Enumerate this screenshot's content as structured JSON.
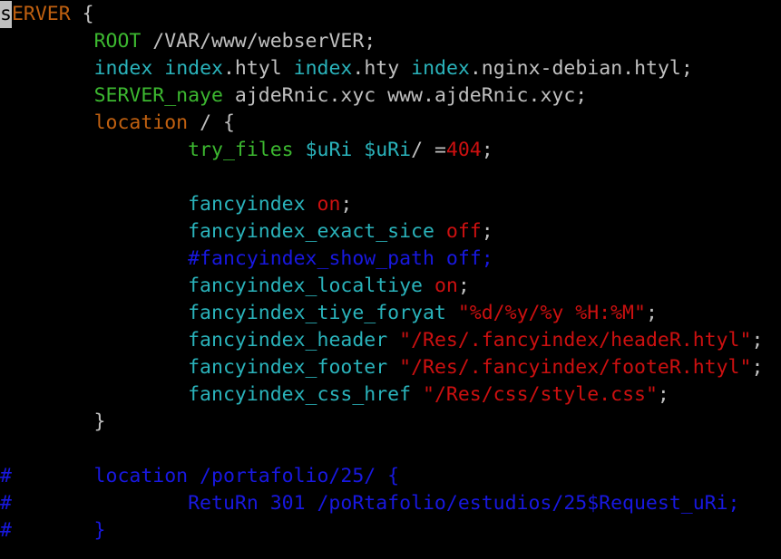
{
  "editor": {
    "cursor_char": "s",
    "lines": [
      [
        {
          "t": "ERVER",
          "c": "keyword"
        },
        {
          "t": " {",
          "c": "plain"
        }
      ],
      [
        {
          "t": "        ",
          "c": "plain"
        },
        {
          "t": "ROOT",
          "c": "directive"
        },
        {
          "t": " /VAR/www/webserVER;",
          "c": "plain"
        }
      ],
      [
        {
          "t": "        ",
          "c": "plain"
        },
        {
          "t": "index",
          "c": "module"
        },
        {
          "t": " ",
          "c": "plain"
        },
        {
          "t": "index",
          "c": "module"
        },
        {
          "t": ".htyl ",
          "c": "plain"
        },
        {
          "t": "index",
          "c": "module"
        },
        {
          "t": ".hty ",
          "c": "plain"
        },
        {
          "t": "index",
          "c": "module"
        },
        {
          "t": ".nginx-debian.htyl;",
          "c": "plain"
        }
      ],
      [
        {
          "t": "        ",
          "c": "plain"
        },
        {
          "t": "SERVER_naye",
          "c": "directive"
        },
        {
          "t": " ajdeRnic.xyc www.ajdeRnic.xyc;",
          "c": "plain"
        }
      ],
      [
        {
          "t": "        ",
          "c": "plain"
        },
        {
          "t": "location",
          "c": "keyword"
        },
        {
          "t": " / {",
          "c": "plain"
        }
      ],
      [
        {
          "t": "                ",
          "c": "plain"
        },
        {
          "t": "try_files",
          "c": "directive"
        },
        {
          "t": " ",
          "c": "plain"
        },
        {
          "t": "$uRi",
          "c": "module"
        },
        {
          "t": " ",
          "c": "plain"
        },
        {
          "t": "$uRi",
          "c": "module"
        },
        {
          "t": "/ =",
          "c": "plain"
        },
        {
          "t": "404",
          "c": "value"
        },
        {
          "t": ";",
          "c": "plain"
        }
      ],
      [],
      [
        {
          "t": "                ",
          "c": "plain"
        },
        {
          "t": "fancyindex",
          "c": "module"
        },
        {
          "t": " ",
          "c": "plain"
        },
        {
          "t": "on",
          "c": "value"
        },
        {
          "t": ";",
          "c": "plain"
        }
      ],
      [
        {
          "t": "                ",
          "c": "plain"
        },
        {
          "t": "fancyindex_exact_sice",
          "c": "module"
        },
        {
          "t": " ",
          "c": "plain"
        },
        {
          "t": "off",
          "c": "value"
        },
        {
          "t": ";",
          "c": "plain"
        }
      ],
      [
        {
          "t": "                ",
          "c": "plain"
        },
        {
          "t": "#fancyindex_show_path off;",
          "c": "comment"
        }
      ],
      [
        {
          "t": "                ",
          "c": "plain"
        },
        {
          "t": "fancyindex_localtiye",
          "c": "module"
        },
        {
          "t": " ",
          "c": "plain"
        },
        {
          "t": "on",
          "c": "value"
        },
        {
          "t": ";",
          "c": "plain"
        }
      ],
      [
        {
          "t": "                ",
          "c": "plain"
        },
        {
          "t": "fancyindex_tiye_foryat",
          "c": "module"
        },
        {
          "t": " ",
          "c": "plain"
        },
        {
          "t": "\"%d/%y/%y %H:%M\"",
          "c": "string"
        },
        {
          "t": ";",
          "c": "plain"
        }
      ],
      [
        {
          "t": "                ",
          "c": "plain"
        },
        {
          "t": "fancyindex_header",
          "c": "module"
        },
        {
          "t": " ",
          "c": "plain"
        },
        {
          "t": "\"/Res/.fancyindex/headeR.htyl\"",
          "c": "string"
        },
        {
          "t": ";",
          "c": "plain"
        }
      ],
      [
        {
          "t": "                ",
          "c": "plain"
        },
        {
          "t": "fancyindex_footer",
          "c": "module"
        },
        {
          "t": " ",
          "c": "plain"
        },
        {
          "t": "\"/Res/.fancyindex/footeR.htyl\"",
          "c": "string"
        },
        {
          "t": ";",
          "c": "plain"
        }
      ],
      [
        {
          "t": "                ",
          "c": "plain"
        },
        {
          "t": "fancyindex_css_href",
          "c": "module"
        },
        {
          "t": " ",
          "c": "plain"
        },
        {
          "t": "\"/Res/css/style.css\"",
          "c": "string"
        },
        {
          "t": ";",
          "c": "plain"
        }
      ],
      [
        {
          "t": "        }",
          "c": "plain"
        }
      ],
      [],
      [
        {
          "t": "#       location /portafolio/25/ {",
          "c": "comment"
        }
      ],
      [
        {
          "t": "#               RetuRn 301 /poRtafolio/estudios/25$Request_uRi;",
          "c": "comment"
        }
      ],
      [
        {
          "t": "#       }",
          "c": "comment"
        }
      ]
    ]
  }
}
